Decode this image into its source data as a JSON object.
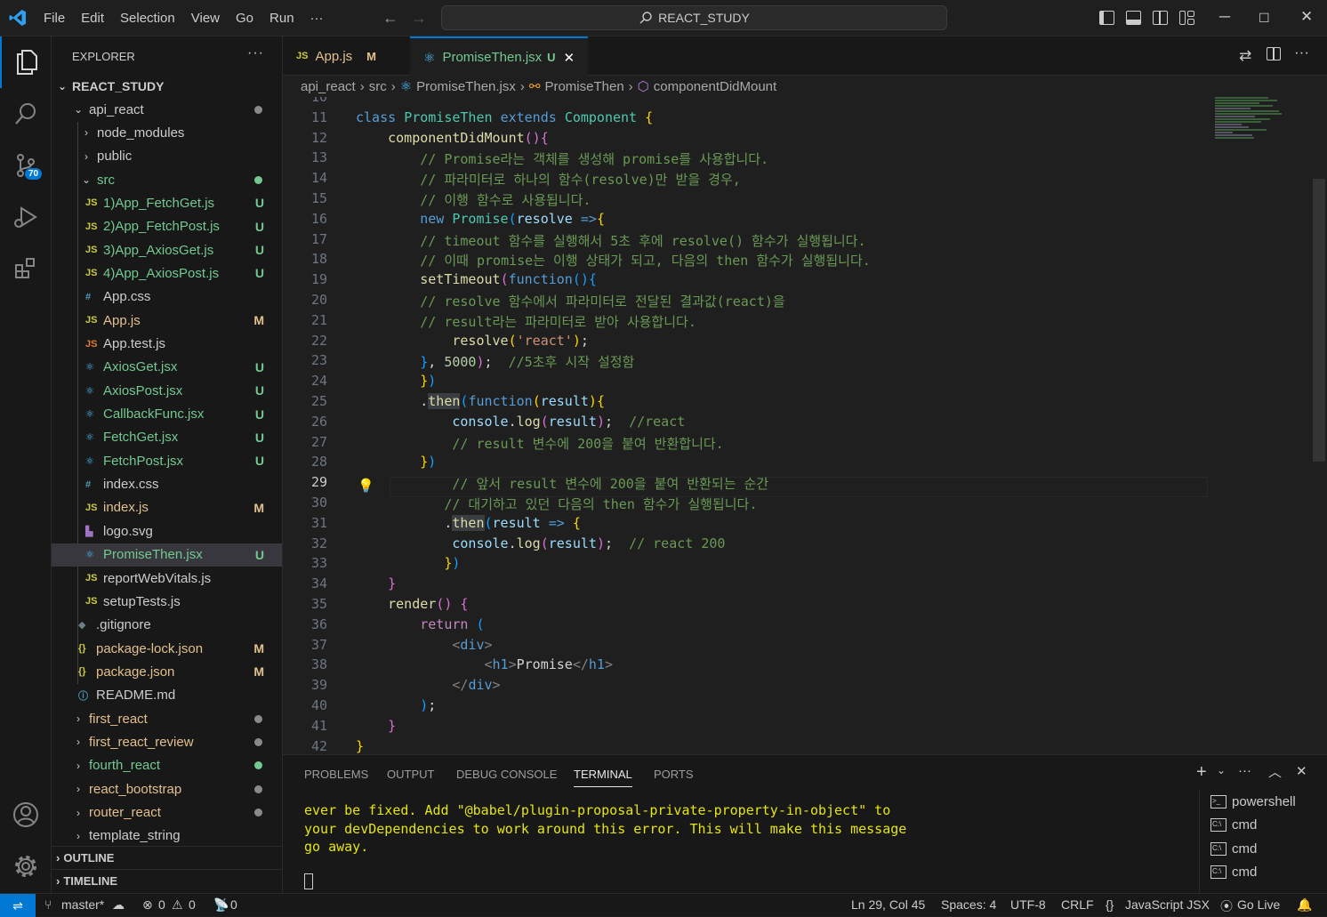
{
  "titlebar": {
    "menu": [
      "File",
      "Edit",
      "Selection",
      "View",
      "Go",
      "Run",
      "···"
    ],
    "search": "REACT_STUDY"
  },
  "activitybar": {
    "scm_badge": "70"
  },
  "explorer": {
    "title": "EXPLORER",
    "more": "···",
    "root": "REACT_STUDY",
    "items": [
      {
        "label": "api_react",
        "kind": "folder-open",
        "color": "#cccccc",
        "dot": "#8a8a8a"
      },
      {
        "label": "node_modules",
        "kind": "folder",
        "color": "#cccccc"
      },
      {
        "label": "public",
        "kind": "folder",
        "color": "#cccccc"
      },
      {
        "label": "src",
        "kind": "folder-open",
        "color": "#73c991",
        "dot": "#73c991"
      },
      {
        "label": "1)App_FetchGet.js",
        "kind": "js",
        "color": "#73c991",
        "status": "U"
      },
      {
        "label": "2)App_FetchPost.js",
        "kind": "js",
        "color": "#73c991",
        "status": "U"
      },
      {
        "label": "3)App_AxiosGet.js",
        "kind": "js",
        "color": "#73c991",
        "status": "U"
      },
      {
        "label": "4)App_AxiosPost.js",
        "kind": "js",
        "color": "#73c991",
        "status": "U"
      },
      {
        "label": "App.css",
        "kind": "css",
        "color": "#cccccc"
      },
      {
        "label": "App.js",
        "kind": "js",
        "color": "#e2c08d",
        "status": "M"
      },
      {
        "label": "App.test.js",
        "kind": "jstest",
        "color": "#cccccc"
      },
      {
        "label": "AxiosGet.jsx",
        "kind": "react",
        "color": "#73c991",
        "status": "U"
      },
      {
        "label": "AxiosPost.jsx",
        "kind": "react",
        "color": "#73c991",
        "status": "U"
      },
      {
        "label": "CallbackFunc.jsx",
        "kind": "react",
        "color": "#73c991",
        "status": "U"
      },
      {
        "label": "FetchGet.jsx",
        "kind": "react",
        "color": "#73c991",
        "status": "U"
      },
      {
        "label": "FetchPost.jsx",
        "kind": "react",
        "color": "#73c991",
        "status": "U"
      },
      {
        "label": "index.css",
        "kind": "css",
        "color": "#cccccc"
      },
      {
        "label": "index.js",
        "kind": "js",
        "color": "#e2c08d",
        "status": "M"
      },
      {
        "label": "logo.svg",
        "kind": "svg",
        "color": "#cccccc"
      },
      {
        "label": "PromiseThen.jsx",
        "kind": "react",
        "color": "#73c991",
        "status": "U",
        "selected": true
      },
      {
        "label": "reportWebVitals.js",
        "kind": "js",
        "color": "#cccccc"
      },
      {
        "label": "setupTests.js",
        "kind": "js",
        "color": "#cccccc"
      },
      {
        "label": ".gitignore",
        "kind": "git",
        "color": "#cccccc"
      },
      {
        "label": "package-lock.json",
        "kind": "json",
        "color": "#e2c08d",
        "status": "M"
      },
      {
        "label": "package.json",
        "kind": "json",
        "color": "#e2c08d",
        "status": "M"
      },
      {
        "label": "README.md",
        "kind": "info",
        "color": "#cccccc"
      },
      {
        "label": "first_react",
        "kind": "folder",
        "color": "#e2c08d",
        "dot": "#8a8a8a"
      },
      {
        "label": "first_react_review",
        "kind": "folder",
        "color": "#e2c08d",
        "dot": "#8a8a8a"
      },
      {
        "label": "fourth_react",
        "kind": "folder",
        "color": "#73c991",
        "dot": "#73c991"
      },
      {
        "label": "react_bootstrap",
        "kind": "folder",
        "color": "#e2c08d",
        "dot": "#8a8a8a"
      },
      {
        "label": "router_react",
        "kind": "folder",
        "color": "#e2c08d",
        "dot": "#8a8a8a"
      },
      {
        "label": "template_string",
        "kind": "folder",
        "color": "#cccccc"
      }
    ],
    "outline": "OUTLINE",
    "timeline": "TIMELINE"
  },
  "tabs": [
    {
      "label": "App.js",
      "status": "M",
      "icon": "JS"
    },
    {
      "label": "PromiseThen.jsx",
      "status": "U",
      "close": "✕"
    }
  ],
  "breadcrumb": [
    "api_react",
    "src",
    "PromiseThen.jsx",
    "PromiseThen",
    "componentDidMount"
  ],
  "editor": {
    "current_line": 29,
    "lines": [
      {
        "n": 10,
        "html": ""
      },
      {
        "n": 11,
        "html": "<span class='t-kw'>class</span> <span class='t-cls'>PromiseThen</span> <span class='t-kw'>extends</span> <span class='t-cls'>Component</span> <span class='t-par'>{</span>"
      },
      {
        "n": 12,
        "html": "    <span class='t-fn'>componentDidMount</span><span class='t-par2'>()</span><span class='t-par2'>{</span>"
      },
      {
        "n": 13,
        "html": "        <span class='t-com'>// Promise라는 객체를 생성해 promise를 사용합니다.</span>"
      },
      {
        "n": 14,
        "html": "        <span class='t-com'>// 파라미터로 하나의 함수(resolve)만 받을 경우,</span>"
      },
      {
        "n": 15,
        "html": "        <span class='t-com'>// 이행 함수로 사용됩니다.</span>"
      },
      {
        "n": 16,
        "html": "        <span class='t-kw'>new</span> <span class='t-cls'>Promise</span><span class='t-par3'>(</span><span class='t-var'>resolve</span> <span class='t-kw'>=&gt;</span><span class='t-par'>{</span>"
      },
      {
        "n": 17,
        "html": "        <span class='t-com'>// timeout 함수를 실행해서 5초 후에 resolve() 함수가 실행됩니다.</span>"
      },
      {
        "n": 18,
        "html": "        <span class='t-com'>// 이때 promise는 이행 상태가 되고, 다음의 then 함수가 실행됩니다.</span>"
      },
      {
        "n": 19,
        "html": "        <span class='t-fn'>setTimeout</span><span class='t-par2'>(</span><span class='t-kw'>function</span><span class='t-par3'>()</span><span class='t-par3'>{</span>"
      },
      {
        "n": 20,
        "html": "        <span class='t-com'>// resolve 함수에서 파라미터로 전달된 결과값(react)을</span>"
      },
      {
        "n": 21,
        "html": "        <span class='t-com'>// result라는 파라미터로 받아 사용합니다.</span>"
      },
      {
        "n": 22,
        "html": "            <span class='t-fn'>resolve</span><span class='t-par'>(</span><span class='t-str'>'react'</span><span class='t-par'>)</span><span class='t-def'>;</span>"
      },
      {
        "n": 23,
        "html": "        <span class='t-par3'>}</span><span class='t-def'>,</span> <span class='t-num'>5000</span><span class='t-par2'>)</span><span class='t-def'>;</span>  <span class='t-com'>//5초후 시작 설정함</span>"
      },
      {
        "n": 24,
        "html": "        <span class='t-par'>}</span><span class='t-par3'>)</span>"
      },
      {
        "n": 25,
        "html": "        <span class='t-def'>.</span><span class='t-fn hl'>then</span><span class='t-par3'>(</span><span class='t-kw'>function</span><span class='t-par'>(</span><span class='t-var'>result</span><span class='t-par'>)</span><span class='t-par'>{</span>"
      },
      {
        "n": 26,
        "html": "            <span class='t-var'>console</span><span class='t-def'>.</span><span class='t-fn'>log</span><span class='t-par2'>(</span><span class='t-var'>result</span><span class='t-par2'>)</span><span class='t-def'>;</span>  <span class='t-com'>//react</span>"
      },
      {
        "n": 27,
        "html": "            <span class='t-com'>// result 변수에 200을 붙여 반환합니다.</span>"
      },
      {
        "n": 28,
        "html": "        <span class='t-par'>}</span><span class='t-par3'>)</span>"
      },
      {
        "n": 29,
        "html": "            <span class='t-com'>// 앞서 result 변수에 200을 붙여 반환되는 순간</span>"
      },
      {
        "n": 30,
        "html": "           <span class='t-com'>// 대기하고 있던 다음의 then 함수가 실행됩니다.</span>"
      },
      {
        "n": 31,
        "html": "           <span class='t-def'>.</span><span class='t-fn hl'>then</span><span class='t-par3'>(</span><span class='t-var'>result</span> <span class='t-kw'>=&gt;</span> <span class='t-par'>{</span>"
      },
      {
        "n": 32,
        "html": "            <span class='t-var'>console</span><span class='t-def'>.</span><span class='t-fn'>log</span><span class='t-par2'>(</span><span class='t-var'>result</span><span class='t-par2'>)</span><span class='t-def'>;</span>  <span class='t-com'>// react 200</span>"
      },
      {
        "n": 33,
        "html": "           <span class='t-par'>}</span><span class='t-par3'>)</span>"
      },
      {
        "n": 34,
        "html": "    <span class='t-par2'>}</span>"
      },
      {
        "n": 35,
        "html": "    <span class='t-fn'>render</span><span class='t-par2'>()</span> <span class='t-par2'>{</span>"
      },
      {
        "n": 36,
        "html": "        <span class='t-ctl'>return</span> <span class='t-par3'>(</span>"
      },
      {
        "n": 37,
        "html": "            <span class='t-punct'>&lt;</span><span class='t-tag'>div</span><span class='t-punct'>&gt;</span>"
      },
      {
        "n": 38,
        "html": "                <span class='t-punct'>&lt;</span><span class='t-tag'>h1</span><span class='t-punct'>&gt;</span><span class='t-def'>Promise</span><span class='t-punct'>&lt;/</span><span class='t-tag'>h1</span><span class='t-punct'>&gt;</span>"
      },
      {
        "n": 39,
        "html": "            <span class='t-punct'>&lt;/</span><span class='t-tag'>div</span><span class='t-punct'>&gt;</span>"
      },
      {
        "n": 40,
        "html": "        <span class='t-par3'>)</span><span class='t-def'>;</span>"
      },
      {
        "n": 41,
        "html": "    <span class='t-par2'>}</span>"
      },
      {
        "n": 42,
        "html": "<span class='t-par'>}</span>"
      }
    ]
  },
  "panel": {
    "tabs": [
      "PROBLEMS",
      "OUTPUT",
      "DEBUG CONSOLE",
      "TERMINAL",
      "PORTS"
    ],
    "active_tab": "TERMINAL",
    "terminal_text": "ever be fixed. Add \"@babel/plugin-proposal-private-property-in-object\" to\nyour devDependencies to work around this error. This will make this message\ngo away.",
    "terminals": [
      "powershell",
      "cmd",
      "cmd",
      "cmd"
    ]
  },
  "statusbar": {
    "branch": "master*",
    "errors": "0",
    "warnings": "0",
    "ports": "0",
    "position": "Ln 29, Col 45",
    "spaces": "Spaces: 4",
    "encoding": "UTF-8",
    "eol": "CRLF",
    "language": "JavaScript JSX",
    "golive": "Go Live"
  }
}
